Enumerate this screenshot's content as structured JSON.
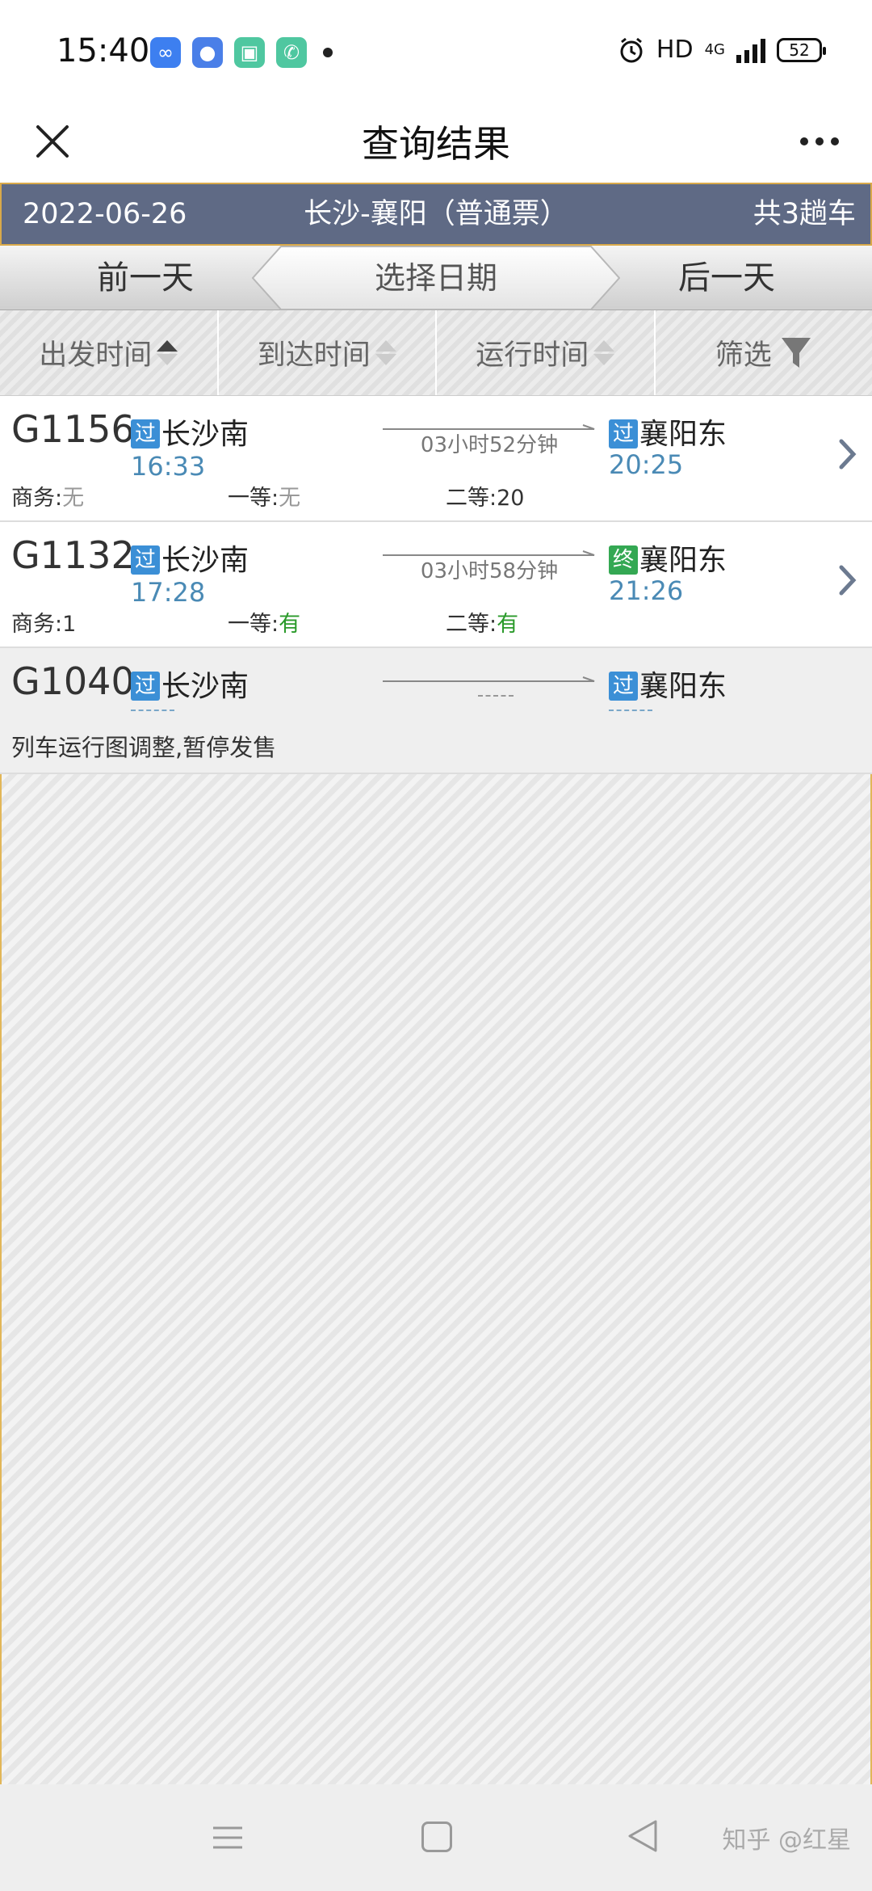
{
  "status_bar": {
    "time": "15:40",
    "network": "HD",
    "signal_type": "4G",
    "battery": "52",
    "apps": [
      {
        "name": "loop-app-icon",
        "color": "#3d7ff0",
        "glyph": "∞"
      },
      {
        "name": "chat-app-icon",
        "color": "#4a7fe8",
        "glyph": "●"
      },
      {
        "name": "cards-app-icon",
        "color": "#4fc7a0",
        "glyph": "▣"
      },
      {
        "name": "phone-app-icon",
        "color": "#4fc7a0",
        "glyph": "✆"
      }
    ]
  },
  "navbar": {
    "title": "查询结果",
    "close_icon": "close-icon",
    "more_icon": "more-icon"
  },
  "info_band": {
    "date": "2022-06-26",
    "route": "长沙-襄阳（普通票）",
    "count": "共3趟车"
  },
  "date_nav": {
    "prev": "前一天",
    "center": "选择日期",
    "next": "后一天"
  },
  "sort_bar": {
    "departure": "出发时间",
    "arrival": "到达时间",
    "duration": "运行时间",
    "filter": "筛选"
  },
  "trains": [
    {
      "code": "G1156",
      "from_badge": "过",
      "from": "长沙南",
      "dep_time": "16:33",
      "duration": "03小时52分钟",
      "to_badge": "过",
      "to": "襄阳东",
      "arr_time": "20:25",
      "seats": [
        {
          "label": "商务:",
          "value": "无"
        },
        {
          "label": "一等:",
          "value": "无"
        },
        {
          "label": "二等:",
          "value": "20"
        }
      ]
    },
    {
      "code": "G1132",
      "from_badge": "过",
      "from": "长沙南",
      "dep_time": "17:28",
      "duration": "03小时58分钟",
      "to_badge": "终",
      "to": "襄阳东",
      "arr_time": "21:26",
      "seats": [
        {
          "label": "商务:",
          "value": "1"
        },
        {
          "label": "一等:",
          "value": "有"
        },
        {
          "label": "二等:",
          "value": "有"
        }
      ]
    },
    {
      "code": "G1040",
      "from_badge": "过",
      "from": "长沙南",
      "to_badge": "过",
      "to": "襄阳东",
      "notice": "列车运行图调整,暂停发售"
    }
  ],
  "bottom_nav": {
    "watermark": "知乎 @红星"
  },
  "colors": {
    "band": "#5f6a85",
    "band_border": "#d9a94a",
    "badge_pass": "#3b8fd6",
    "badge_end": "#34a853",
    "time_blue": "#4a8ab5",
    "available_green": "#2a9a2a"
  }
}
